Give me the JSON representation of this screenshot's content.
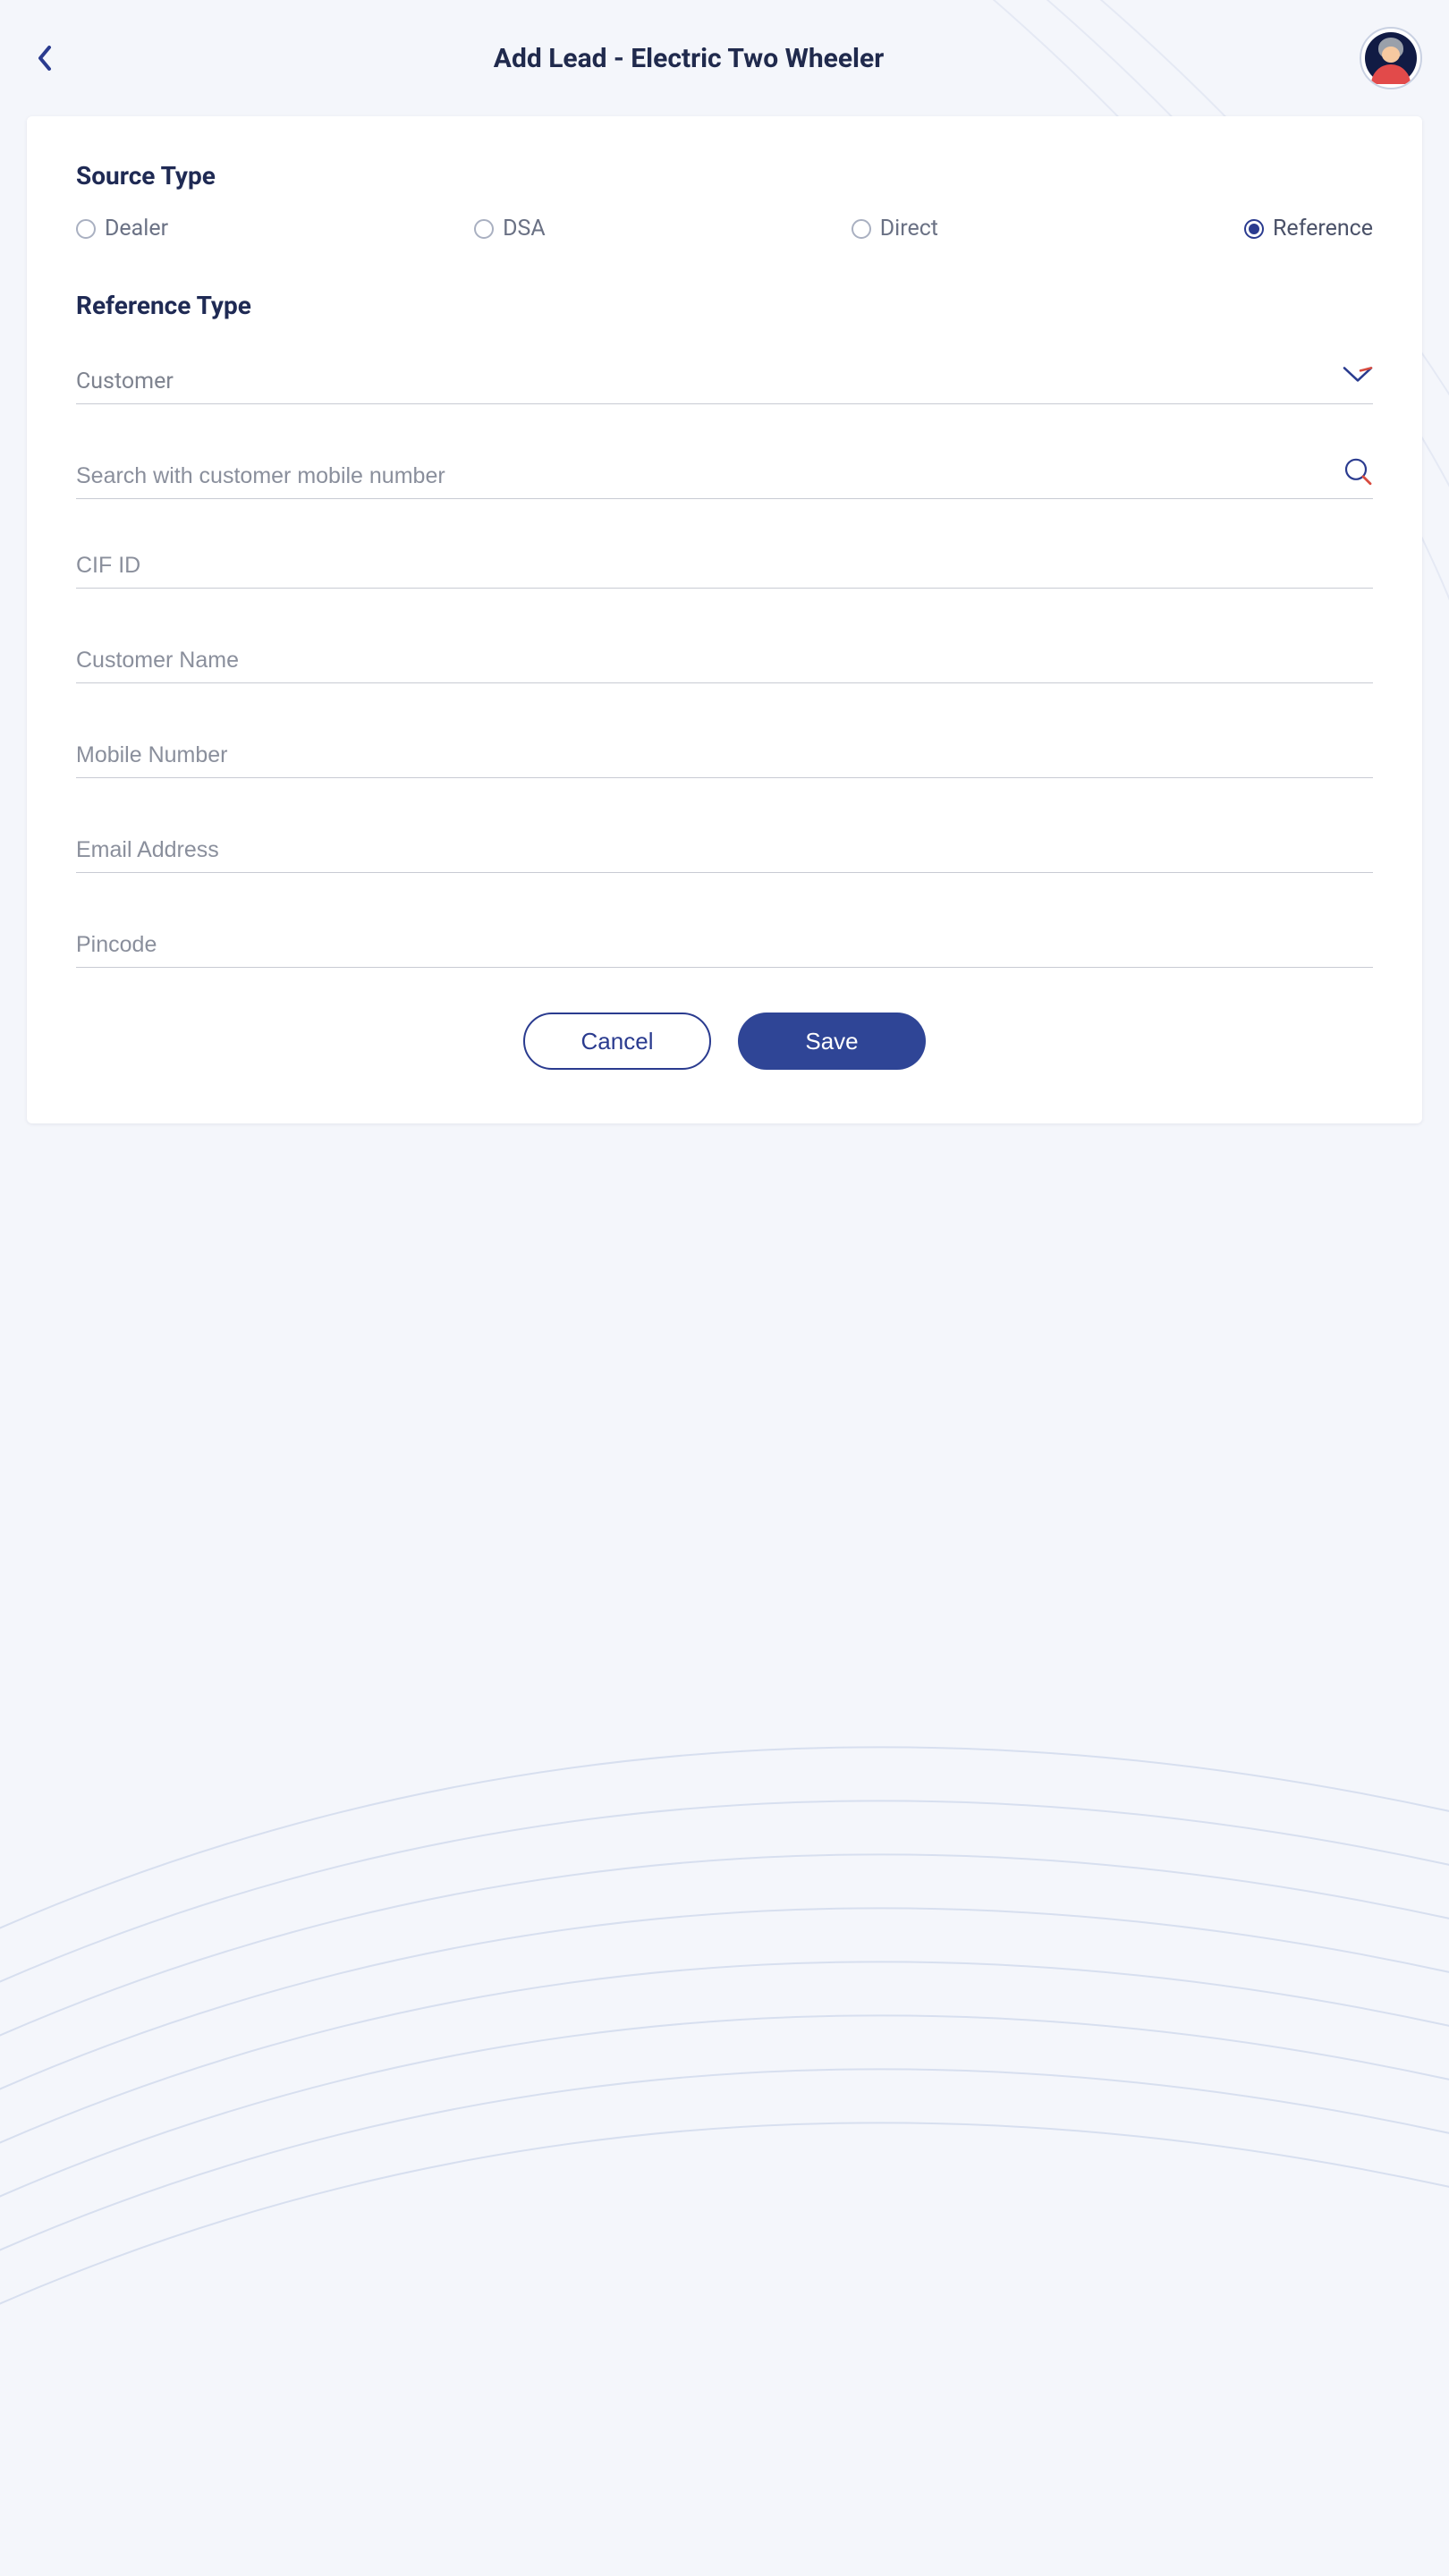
{
  "header": {
    "title": "Add Lead - Electric Two Wheeler"
  },
  "form": {
    "source_type": {
      "label": "Source Type",
      "selected": "reference",
      "options": {
        "dealer": "Dealer",
        "dsa": "DSA",
        "direct": "Direct",
        "reference": "Reference"
      }
    },
    "reference_type": {
      "label": "Reference Type",
      "value": "Customer"
    },
    "search": {
      "placeholder": "Search with customer mobile number"
    },
    "cif": {
      "placeholder": "CIF ID"
    },
    "customer_name": {
      "placeholder": "Customer Name"
    },
    "mobile": {
      "placeholder": "Mobile Number"
    },
    "email": {
      "placeholder": "Email Address"
    },
    "pincode": {
      "placeholder": "Pincode"
    }
  },
  "actions": {
    "cancel": "Cancel",
    "save": "Save"
  },
  "colors": {
    "brand": "#2f4596",
    "accent_red": "#d84b3f"
  }
}
